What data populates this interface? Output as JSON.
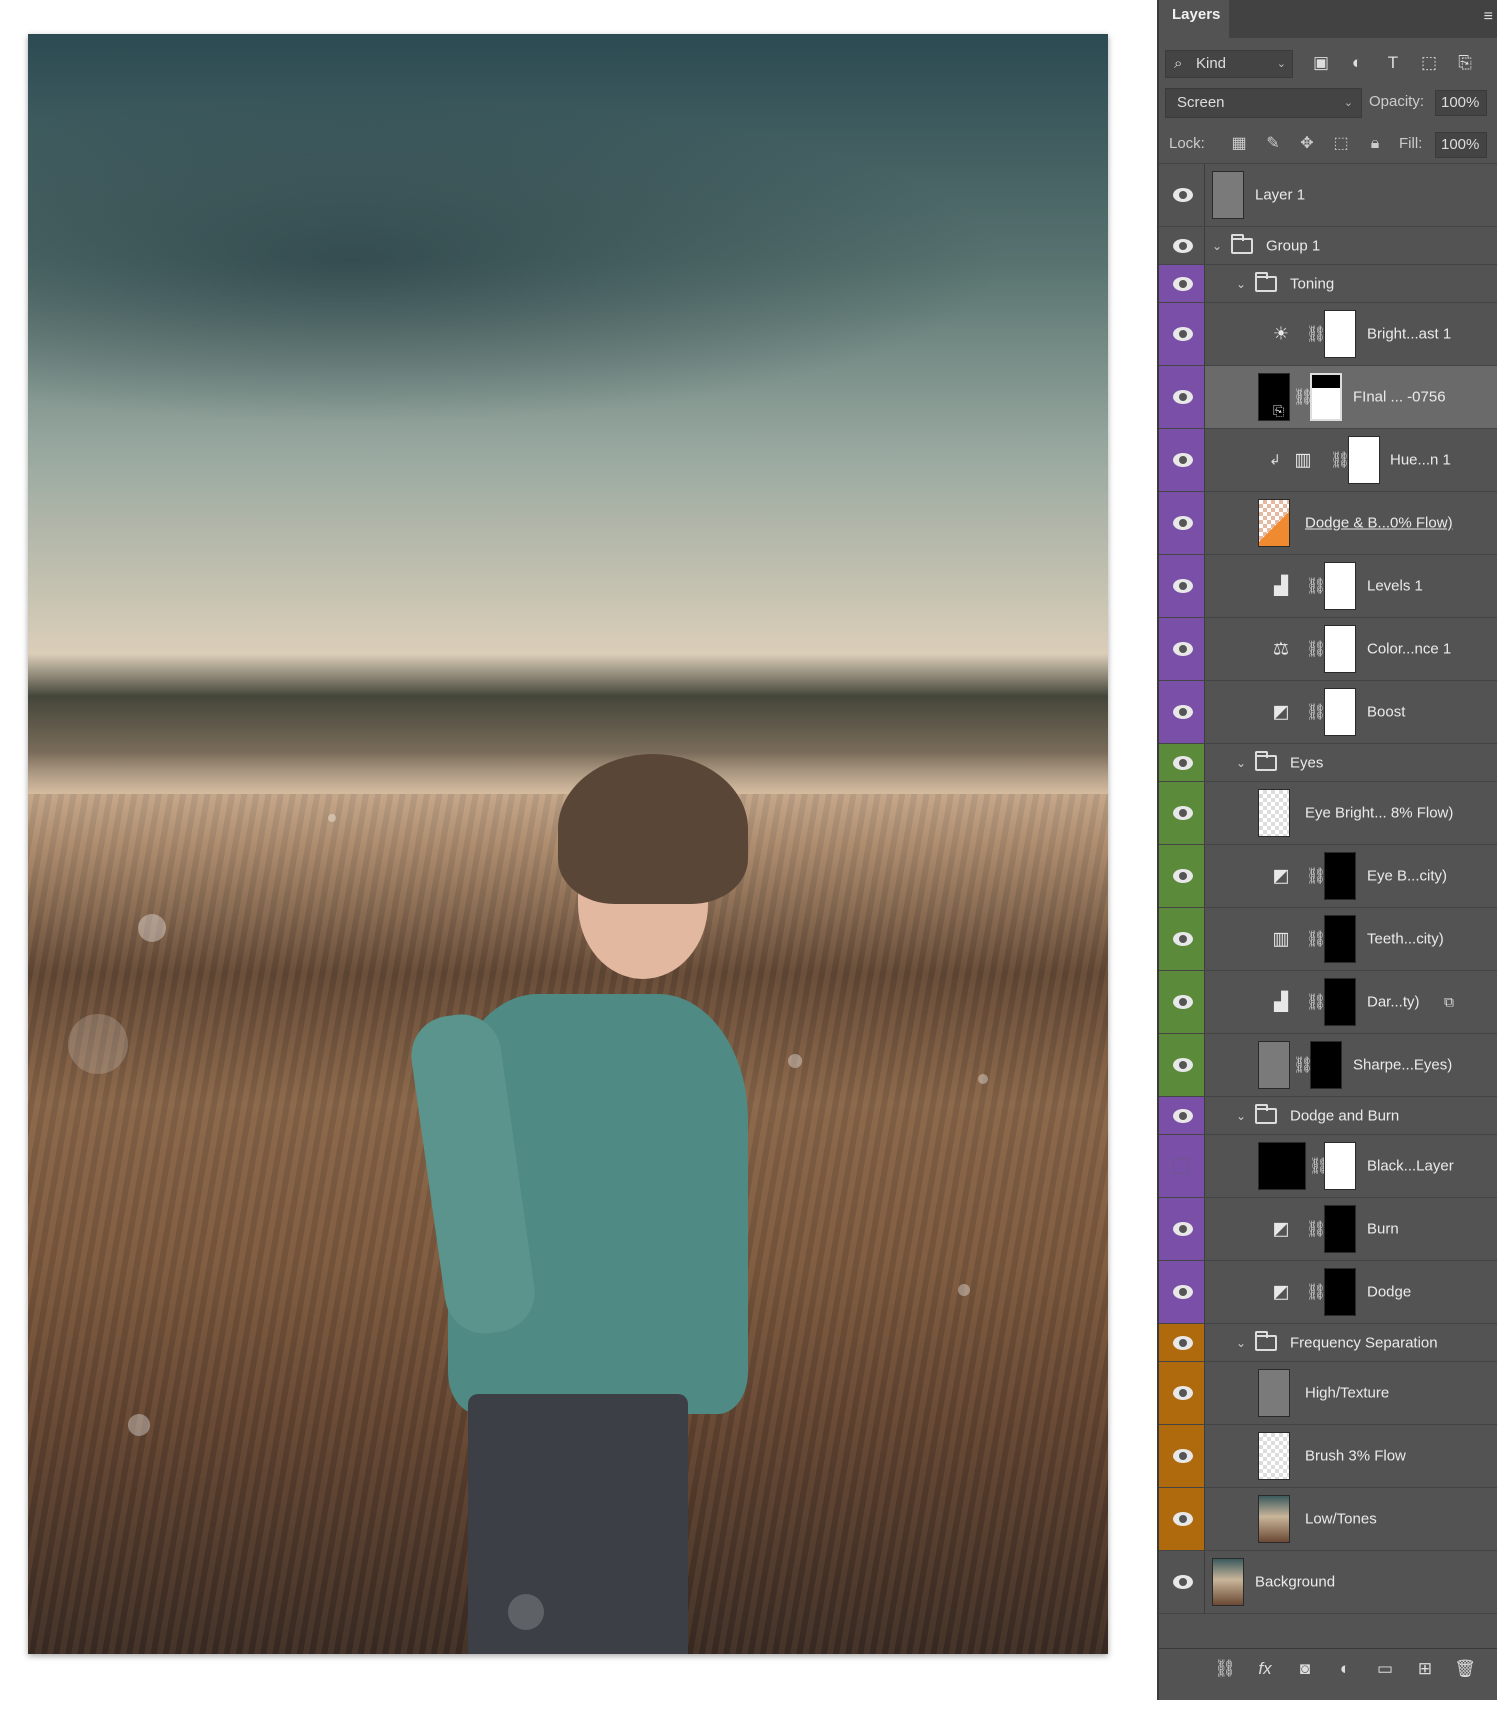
{
  "panel": {
    "tab_label": "Layers",
    "filter_kind": "Kind",
    "blend_mode": "Screen",
    "opacity_label": "Opacity:",
    "opacity_value": "100%",
    "lock_label": "Lock:",
    "fill_label": "Fill:",
    "fill_value": "100%"
  },
  "icons": {
    "filter": [
      "image-filter-icon",
      "adjustment-filter-icon",
      "type-filter-icon",
      "shape-filter-icon",
      "smart-object-filter-icon"
    ],
    "lock": [
      "lock-transparent-icon",
      "lock-image-icon",
      "lock-position-icon",
      "lock-artboard-icon",
      "lock-all-icon"
    ],
    "footer": [
      "link-layers-icon",
      "fx-icon",
      "add-mask-icon",
      "new-adjustment-icon",
      "new-group-icon",
      "new-layer-icon",
      "delete-layer-icon"
    ]
  },
  "colors": {
    "purple_label": "#7a4fa8",
    "green_label": "#5a8a3a",
    "orange_label": "#b06a0e",
    "panel_bg": "#535353"
  },
  "layers": [
    {
      "name": "Layer 1"
    },
    {
      "name": "Group 1"
    },
    {
      "name": "Toning"
    },
    {
      "name": "Bright...ast 1"
    },
    {
      "name": "FInal ... -0756"
    },
    {
      "name": "Hue...n 1"
    },
    {
      "name": "Dodge & B...0% Flow)"
    },
    {
      "name": "Levels 1"
    },
    {
      "name": "Color...nce 1"
    },
    {
      "name": "Boost"
    },
    {
      "name": "Eyes"
    },
    {
      "name": "Eye Bright... 8% Flow)"
    },
    {
      "name": "Eye B...city)"
    },
    {
      "name": "Teeth...city)"
    },
    {
      "name": "Dar...ty)"
    },
    {
      "name": "Sharpe...Eyes)"
    },
    {
      "name": "Dodge and Burn"
    },
    {
      "name": "Black...Layer"
    },
    {
      "name": "Burn"
    },
    {
      "name": "Dodge"
    },
    {
      "name": "Frequency Separation"
    },
    {
      "name": "High/Texture"
    },
    {
      "name": "Brush 3% Flow"
    },
    {
      "name": "Low/Tones"
    },
    {
      "name": "Background"
    }
  ]
}
